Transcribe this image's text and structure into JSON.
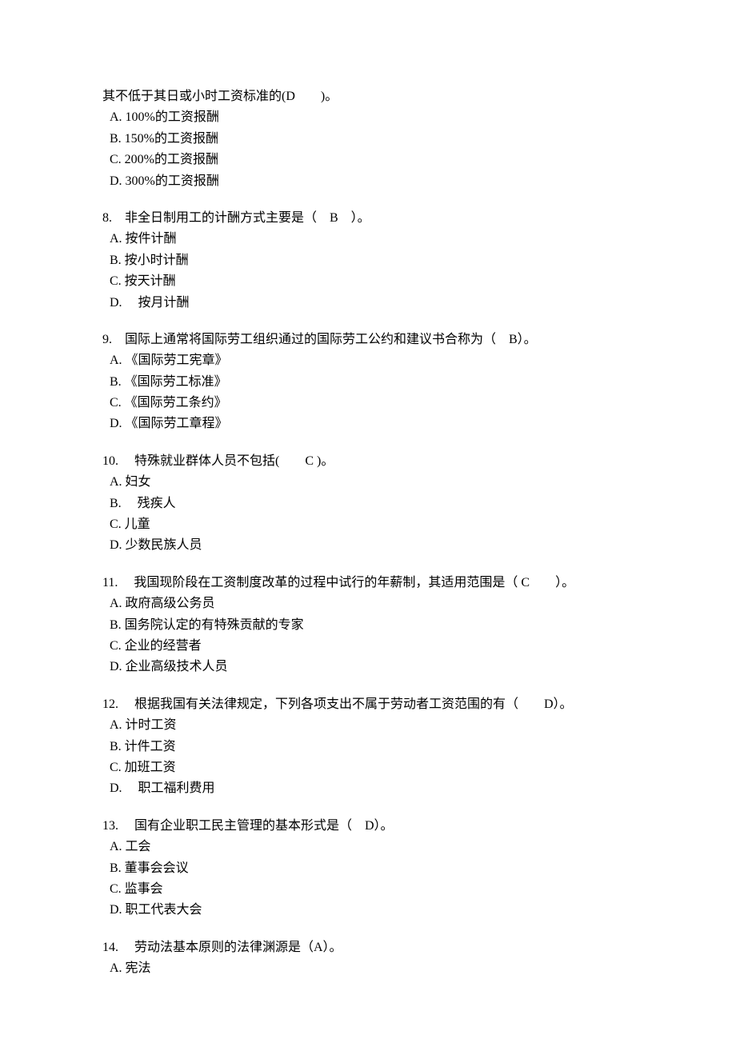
{
  "q7_tail": {
    "stem": "其不低于其日或小时工资标准的(D　　)。",
    "opts": [
      "A. 100%的工资报酬",
      "B. 150%的工资报酬",
      "C. 200%的工资报酬",
      "D. 300%的工资报酬"
    ]
  },
  "q8": {
    "stem": "8.　非全日制用工的计酬方式主要是（　B　）。",
    "opts": [
      "A.  按件计酬",
      "B.  按小时计酬",
      "C.  按天计酬",
      "D. 　按月计酬"
    ]
  },
  "q9": {
    "stem": "9.　国际上通常将国际劳工组织通过的国际劳工公约和建议书合称为（　B）。",
    "opts": [
      "A.  《国际劳工宪章》",
      "B.  《国际劳工标准》",
      "C.  《国际劳工条约》",
      "D.  《国际劳工章程》"
    ]
  },
  "q10": {
    "stem": "10.　 特殊就业群体人员不包括(　　C )。",
    "opts": [
      "A.  妇女",
      "B. 　残疾人",
      "C.  儿童",
      "D.  少数民族人员"
    ]
  },
  "q11": {
    "stem": "11.　 我国现阶段在工资制度改革的过程中试行的年薪制，其适用范围是（ C　　）。",
    "opts": [
      "A.  政府高级公务员",
      "B.  国务院认定的有特殊贡献的专家",
      "C.  企业的经营者",
      "D.  企业高级技术人员"
    ]
  },
  "q12": {
    "stem": "12.　 根据我国有关法律规定，下列各项支出不属于劳动者工资范围的有（　　D）。",
    "opts": [
      "A.  计时工资",
      "B.  计件工资",
      "C.  加班工资",
      "D. 　职工福利费用"
    ]
  },
  "q13": {
    "stem": "13.　 国有企业职工民主管理的基本形式是（　D）。",
    "opts": [
      "A.  工会",
      "B.  董事会会议",
      "C.  监事会",
      "D.  职工代表大会"
    ]
  },
  "q14": {
    "stem": "14.　 劳动法基本原则的法律渊源是（A）。",
    "opts": [
      "A.  宪法"
    ]
  }
}
